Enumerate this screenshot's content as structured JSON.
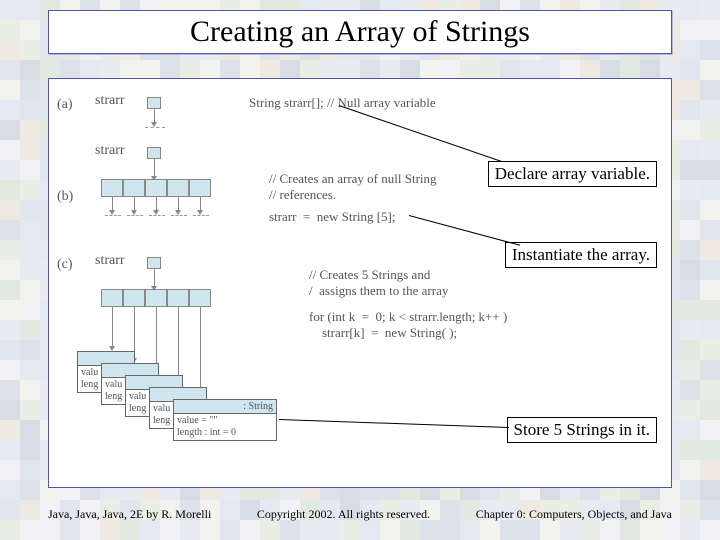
{
  "title": "Creating an Array of Strings",
  "callouts": {
    "declare": "Declare array variable.",
    "instantiate": "Instantiate the array.",
    "store": "Store 5 Strings in it."
  },
  "sections": {
    "a": "(a)",
    "b": "(b)",
    "c": "(c)"
  },
  "labels": {
    "strarr": "strarr"
  },
  "code": {
    "a": "String strarr[]; // Null array variable",
    "b_comment": "// Creates an array of null String\n// references.",
    "b_stmt": "strarr  =  new String [5];",
    "c_comment": "// Creates 5 Strings and\n/  assigns them to the array",
    "c_loop": "for (int k  =  0; k < strarr.length; k++ )\n    strarr[k]  =  new String( );"
  },
  "obj": {
    "class": ": String",
    "val": "value = \"\"",
    "len": "length : int = 0",
    "valu_frag": "valu",
    "leng_frag": "leng"
  },
  "footer": {
    "left": "Java, Java, Java, 2E by R. Morelli",
    "mid": "Copyright 2002. All rights reserved.",
    "right": "Chapter 0: Computers, Objects, and Java"
  }
}
